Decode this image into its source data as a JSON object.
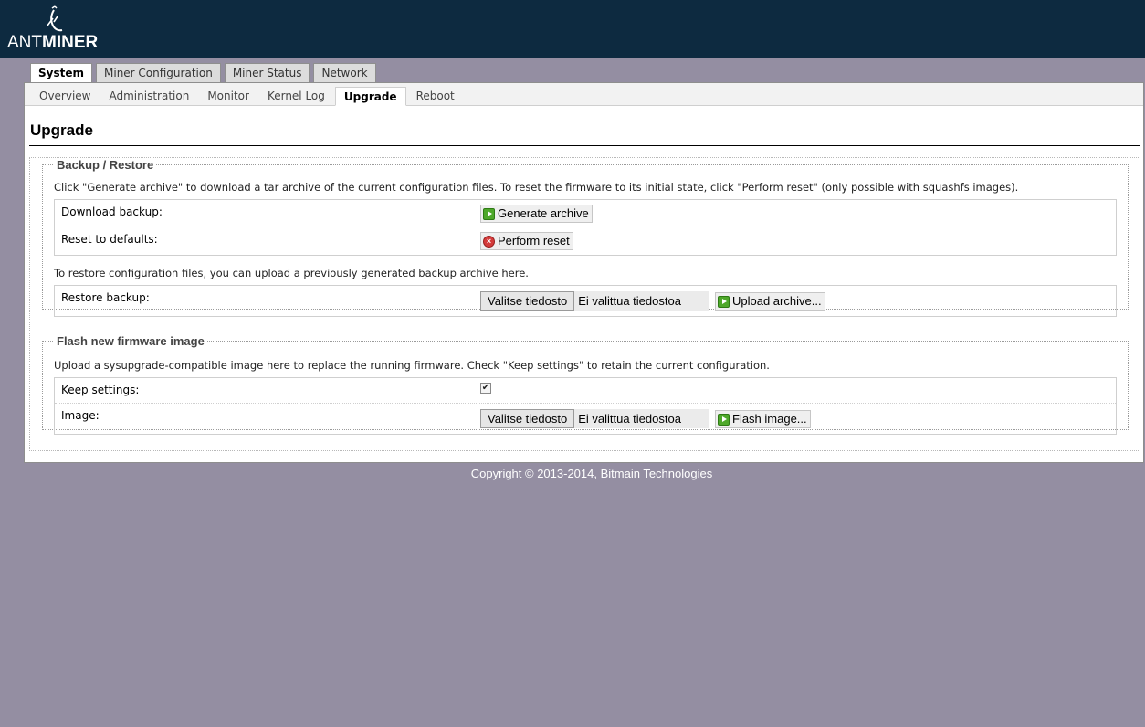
{
  "header": {
    "logo_part1": "ANT",
    "logo_part2": "MINER",
    "logo_icon": "antminer-ant-icon"
  },
  "top_tabs": [
    {
      "label": "System",
      "active": true
    },
    {
      "label": "Miner Configuration",
      "active": false
    },
    {
      "label": "Miner Status",
      "active": false
    },
    {
      "label": "Network",
      "active": false
    }
  ],
  "sub_tabs": [
    {
      "label": "Overview",
      "active": false
    },
    {
      "label": "Administration",
      "active": false
    },
    {
      "label": "Monitor",
      "active": false
    },
    {
      "label": "Kernel Log",
      "active": false
    },
    {
      "label": "Upgrade",
      "active": true
    },
    {
      "label": "Reboot",
      "active": false
    }
  ],
  "page": {
    "title": "Upgrade"
  },
  "backup": {
    "legend": "Backup / Restore",
    "description": "Click \"Generate archive\" to download a tar archive of the current configuration files. To reset the firmware to its initial state, click \"Perform reset\" (only possible with squashfs images).",
    "download_label": "Download backup:",
    "generate_button": "Generate archive",
    "reset_label": "Reset to defaults:",
    "reset_button": "Perform reset",
    "restore_description": "To restore configuration files, you can upload a previously generated backup archive here.",
    "restore_label": "Restore backup:",
    "file_button": "Valitse tiedosto",
    "file_status": "Ei valittua tiedostoa",
    "upload_button": "Upload archive..."
  },
  "flash": {
    "legend": "Flash new firmware image",
    "description": "Upload a sysupgrade-compatible image here to replace the running firmware. Check \"Keep settings\" to retain the current configuration.",
    "keep_label": "Keep settings:",
    "keep_checked": true,
    "image_label": "Image:",
    "file_button": "Valitse tiedosto",
    "file_status": "Ei valittua tiedostoa",
    "flash_button": "Flash image..."
  },
  "footer": {
    "copyright": "Copyright © 2013-2014, Bitmain Technologies"
  },
  "colors": {
    "header_bg": "#0d2a40",
    "page_bg": "#948ea2",
    "accent_green": "#4ea82a",
    "accent_red": "#d33a3a"
  }
}
